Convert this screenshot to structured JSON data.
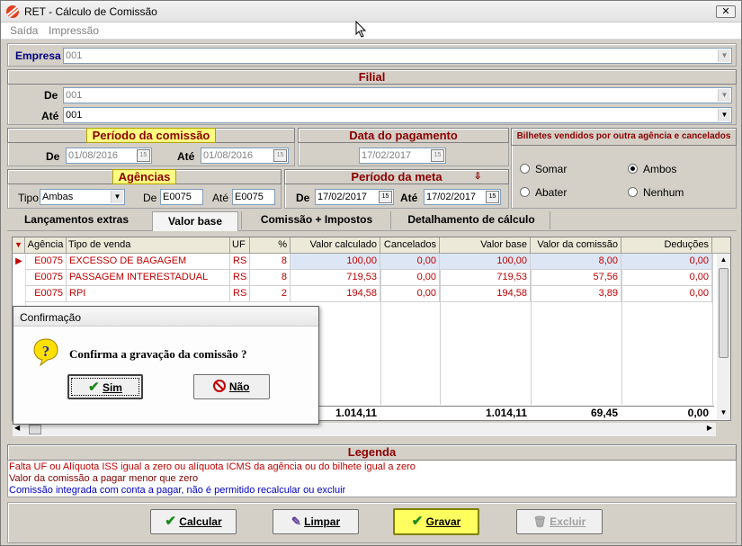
{
  "window": {
    "title": "RET - Cálculo de Comissão"
  },
  "menu": [
    "Saída",
    "Impressão"
  ],
  "empresa": {
    "label": "Empresa",
    "value": "001"
  },
  "filial": {
    "header": "Filial",
    "de_label": "De",
    "de_value": "001",
    "ate_label": "Até",
    "ate_value": "001"
  },
  "periodo_comissao": {
    "header": "Período da comissão",
    "de_label": "De",
    "de_value": "01/08/2016",
    "ate_label": "Até",
    "ate_value": "01/08/2016"
  },
  "data_pagamento": {
    "header": "Data do pagamento",
    "value": "17/02/2017"
  },
  "bilhetes": {
    "header": "Bilhetes vendidos por outra agência e cancelados",
    "options": [
      {
        "label": "Somar",
        "selected": false
      },
      {
        "label": "Ambos",
        "selected": true
      },
      {
        "label": "Abater",
        "selected": false
      },
      {
        "label": "Nenhum",
        "selected": false
      }
    ]
  },
  "agencias": {
    "header": "Agências",
    "tipo_label": "Tipo",
    "tipo_value": "Ambas",
    "de_label": "De",
    "de_value": "E0075",
    "ate_label": "Até",
    "ate_value": "E0075"
  },
  "periodo_meta": {
    "header": "Período da meta",
    "de_label": "De",
    "de_value": "17/02/2017",
    "ate_label": "Até",
    "ate_value": "17/02/2017"
  },
  "tabs": [
    "Lançamentos extras",
    "Valor base",
    "Comissão + Impostos",
    "Detalhamento de cálculo"
  ],
  "grid": {
    "columns": [
      "Agência",
      "Tipo de venda",
      "UF",
      "%",
      "Valor calculado",
      "Cancelados",
      "Valor base",
      "Valor da comissão",
      "Deduções"
    ],
    "rows": [
      [
        "E0075",
        "EXCESSO DE BAGAGEM",
        "RS",
        "8",
        "100,00",
        "0,00",
        "100,00",
        "8,00",
        "0,00"
      ],
      [
        "E0075",
        "PASSAGEM INTERESTADUAL",
        "RS",
        "8",
        "719,53",
        "0,00",
        "719,53",
        "57,56",
        "0,00"
      ],
      [
        "E0075",
        "RPI",
        "RS",
        "2",
        "194,58",
        "0,00",
        "194,58",
        "3,89",
        "0,00"
      ]
    ],
    "totals": {
      "valor_calculado": "1.014,11",
      "valor_base": "1.014,11",
      "valor_comissao": "69,45",
      "deducoes": "0,00"
    }
  },
  "dialog": {
    "title": "Confirmação",
    "message": "Confirma a gravação da comissão ?",
    "yes_label": "Sim",
    "no_label": "Não"
  },
  "legend": {
    "header": "Legenda",
    "items": [
      {
        "text": "Falta UF ou Alíquota ISS igual a zero ou alíquota ICMS da agência ou do bilhete igual a zero",
        "color": "#c00000"
      },
      {
        "text": "Valor da comissão a pagar menor que zero",
        "color": "#800000"
      },
      {
        "text": "Comissão integrada com conta a pagar, não é permitido recalcular ou excluir",
        "color": "#0000c0"
      }
    ]
  },
  "buttons": {
    "calcular": "Calcular",
    "limpar": "Limpar",
    "gravar": "Gravar",
    "excluir": "Excluir"
  }
}
